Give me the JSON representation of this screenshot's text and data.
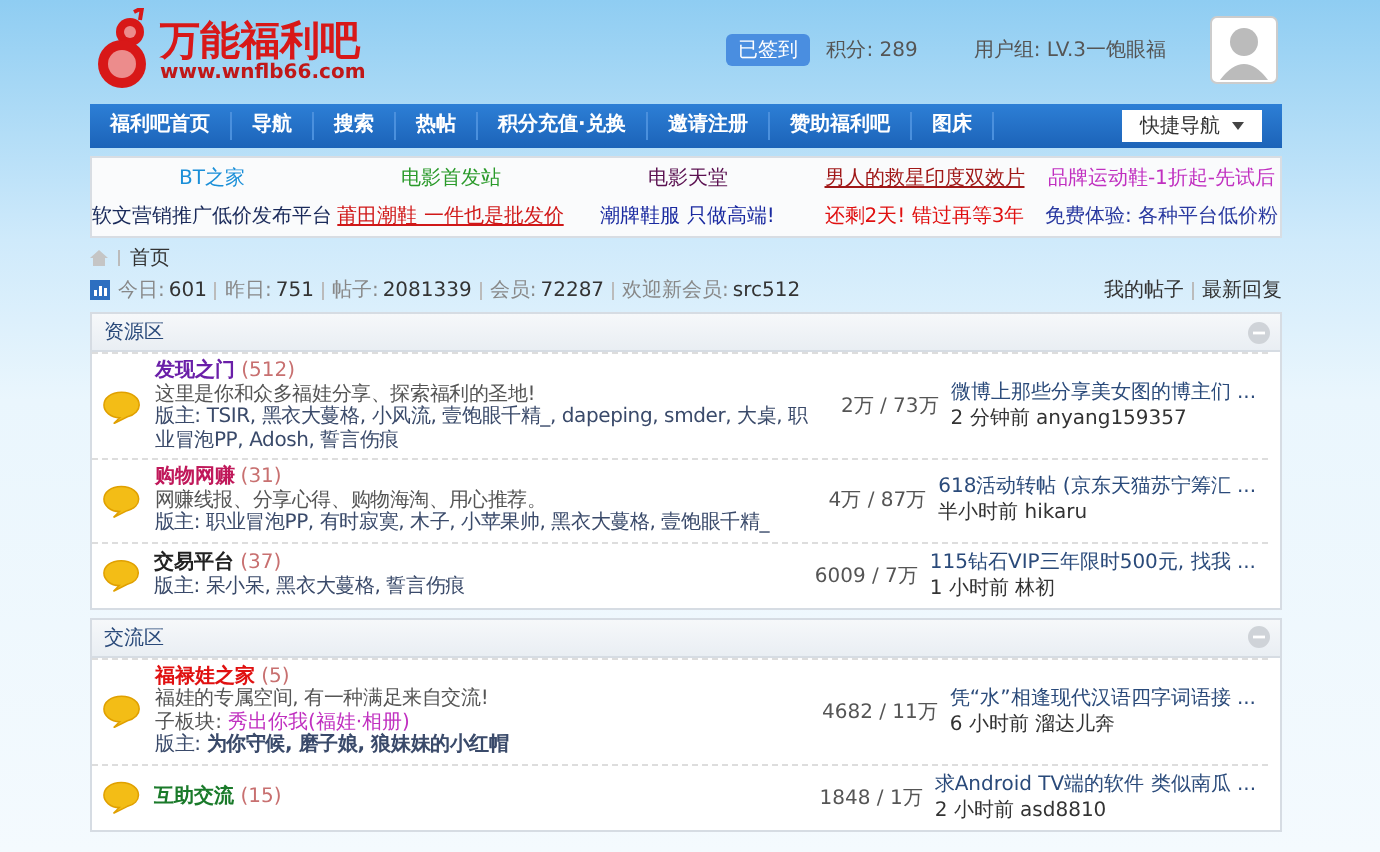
{
  "header": {
    "logo_title": "万能福利吧",
    "logo_url": "www.wnflb66.com",
    "signed_badge": "已签到",
    "points": "积分: 289",
    "user_group": "用户组: LV.3一饱眼福"
  },
  "nav": {
    "items": [
      {
        "label": "福利吧首页"
      },
      {
        "label": "导航"
      },
      {
        "label": "搜索"
      },
      {
        "label": "热帖"
      },
      {
        "label": "积分充值·兑换"
      },
      {
        "label": "邀请注册"
      },
      {
        "label": "赞助福利吧"
      },
      {
        "label": "图床"
      }
    ],
    "quick_nav": "快捷导航"
  },
  "promo_links": [
    {
      "text": "BT之家",
      "color": "#1a8fd8",
      "underlined": false
    },
    {
      "text": "电影首发站",
      "color": "#2a9a2a",
      "underlined": false
    },
    {
      "text": "电影天堂",
      "color": "#5a1050",
      "underlined": false
    },
    {
      "text": "男人的救星印度双效片",
      "color": "#a01818",
      "underlined": true
    },
    {
      "text": "品牌运动鞋-1折起-先试后",
      "color": "#c030c0",
      "underlined": false
    },
    {
      "text": "软文营销推广低价发布平台",
      "color": "#1a2a5a",
      "underlined": false
    },
    {
      "text": "莆田潮鞋 一件也是批发价",
      "color": "#d01818",
      "underlined": true
    },
    {
      "text": "潮牌鞋服 只做高端!",
      "color": "#1a2aa0",
      "underlined": false
    },
    {
      "text": "还剩2天! 错过再等3年",
      "color": "#e01010",
      "underlined": false
    },
    {
      "text": "免费体验: 各种平台低价粉",
      "color": "#2a3aa0",
      "underlined": false
    }
  ],
  "breadcrumb": "首页",
  "stats": [
    {
      "label": "今日:",
      "value": "601"
    },
    {
      "label": "昨日:",
      "value": "751"
    },
    {
      "label": "帖子:",
      "value": "2081339"
    },
    {
      "label": "会员:",
      "value": "72287"
    },
    {
      "label": "欢迎新会员:",
      "value": "src512"
    }
  ],
  "stats_links": [
    "我的帖子",
    "最新回复"
  ],
  "sections": [
    {
      "title": "资源区",
      "forums": [
        {
          "name": "发现之门",
          "color": "#6a1fa8",
          "count": "(512)",
          "description": "这里是你和众多福娃分享、探索福利的圣地!",
          "moderators": "版主: TSIR, 黑衣大蔓格, 小风流, 壹饱眼千精_, dapeping, smder, 大桌, 职业冒泡PP, Adosh, 誓言伤痕",
          "counts": "2万 / 73万",
          "last_title": "微博上那些分享美女图的博主们 ...",
          "last_meta": "2 分钟前 anyang159357"
        },
        {
          "name": "购物网赚",
          "color": "#c0185a",
          "count": "(31)",
          "description": "网赚线报、分享心得、购物海淘、用心推荐。",
          "moderators": "版主: 职业冒泡PP, 有时寂寞, 木子, 小苹果帅, 黑衣大蔓格, 壹饱眼千精_",
          "counts": "4万 / 87万",
          "last_title": "618活动转帖 (京东天猫苏宁筹汇 ...",
          "last_meta": "半小时前 hikaru"
        },
        {
          "name": "交易平台",
          "color": "#222222",
          "count": "(37)",
          "moderators": "版主: 呆小呆, 黑衣大蔓格, 誓言伤痕",
          "counts": "6009 / 7万",
          "last_title": "115钻石VIP三年限时500元, 找我 ...",
          "last_meta": "1 小时前 林初"
        }
      ]
    },
    {
      "title": "交流区",
      "forums": [
        {
          "name": "福禄娃之家",
          "color": "#e01010",
          "count": "(5)",
          "description": "福娃的专属空间, 有一种满足来自交流!",
          "subforum_label": "子板块:",
          "subforum": "秀出你我(福娃·相册)",
          "moderators": "版主: **为你守候, 磨子娘, 狼妹妹的小红帽**",
          "counts": "4682 / 11万",
          "last_title": "凭“水”相逢现代汉语四字词语接 ...",
          "last_meta": "6 小时前 溜达儿奔"
        },
        {
          "name": "互助交流",
          "color": "#1a7a2a",
          "count": "(15)",
          "counts": "1848 / 1万",
          "last_title": "求Android TV端的软件 类似南瓜 ...",
          "last_meta": "2 小时前 asd8810"
        }
      ]
    }
  ]
}
